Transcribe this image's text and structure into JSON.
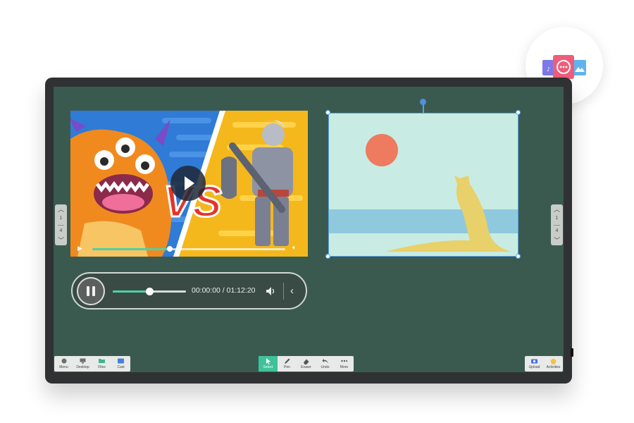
{
  "board": {
    "page_indicator_left": {
      "current": "1",
      "total": "4"
    },
    "page_indicator_right": {
      "current": "1",
      "total": "4"
    }
  },
  "video_player": {
    "overlay_text": "VS",
    "progress_percent": 40
  },
  "audio_player": {
    "time": "00:00:00 / 01:12:20",
    "progress_percent": 50
  },
  "toolbar_left": [
    {
      "label": "Menu",
      "icon": "menu-icon"
    },
    {
      "label": "Desktop",
      "icon": "monitor-icon"
    },
    {
      "label": "Files",
      "icon": "folder-icon"
    },
    {
      "label": "Cast",
      "icon": "cast-icon"
    }
  ],
  "toolbar_center": [
    {
      "label": "Select",
      "icon": "cursor-icon",
      "active": true
    },
    {
      "label": "Pen",
      "icon": "pen-icon"
    },
    {
      "label": "Eraser",
      "icon": "eraser-icon"
    },
    {
      "label": "Undo",
      "icon": "undo-icon"
    },
    {
      "label": "More",
      "icon": "more-icon"
    }
  ],
  "toolbar_right": [
    {
      "label": "Upload",
      "icon": "camera-icon"
    },
    {
      "label": "Activities",
      "icon": "activities-icon"
    }
  ],
  "colors": {
    "board": "#3b5a4f",
    "accent": "#3fc29a",
    "selection": "#5aa2e6"
  }
}
